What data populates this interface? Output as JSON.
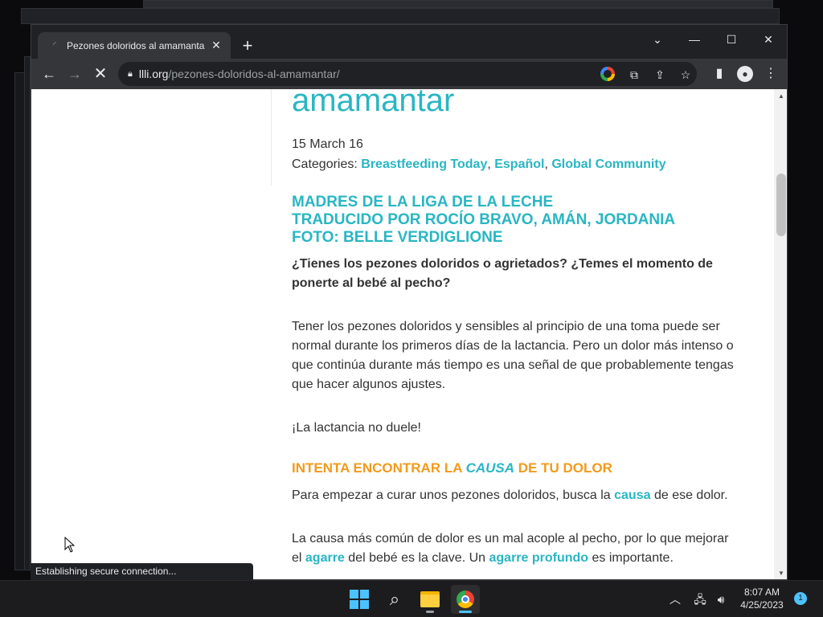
{
  "browser": {
    "tab_title": "Pezones doloridos al amamantar",
    "url_domain": "llli.org",
    "url_path": "/pezones-doloridos-al-amamantar/",
    "status_text": "Establishing secure connection..."
  },
  "article": {
    "title_fragment": "amamantar",
    "date": "15 March 16",
    "categories_label": "Categories: ",
    "categories": [
      "Breastfeeding Today",
      "Español",
      "Global Community"
    ],
    "credits": [
      "MADRES DE LA LIGA DE LA LECHE",
      "TRADUCIDO POR ROCÍO BRAVO, AMÁN, JORDANIA",
      "FOTO: BELLE VERDIGLIONE"
    ],
    "intro": "¿Tienes los pezones doloridos o agrietados? ¿Temes el momento de ponerte al bebé al pecho?",
    "para1": "Tener los pezones doloridos y sensibles al principio de una toma puede ser normal durante los primeros días de la lactancia. Pero un dolor más intenso o que continúa durante más tiempo es una señal de que probablemente tengas que hacer algunos ajustes.",
    "para2": "¡La lactancia no duele!",
    "heading_pre": "INTENTA ENCONTRAR LA ",
    "heading_em": "CAUSA",
    "heading_post": " DE TU DOLOR",
    "para3_pre": "Para empezar a curar unos pezones doloridos, busca la ",
    "para3_link": "causa",
    "para3_post": " de ese dolor.",
    "para4_pre": "La causa más común de dolor es un mal acople al pecho, por lo que mejorar el ",
    "para4_link1": "agarre",
    "para4_mid": " del bebé es la clave. Un ",
    "para4_link2": "agarre profundo",
    "para4_post": " es importante."
  },
  "taskbar": {
    "time": "8:07 AM",
    "date": "4/25/2023",
    "notification_count": "1"
  },
  "colors": {
    "accent_teal": "#29b6c3",
    "accent_orange": "#f29a1a"
  }
}
